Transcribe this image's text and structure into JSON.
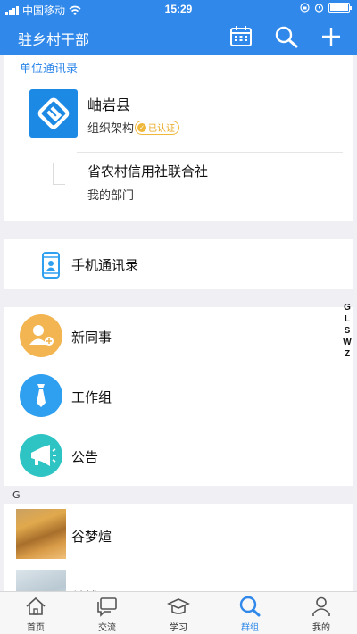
{
  "status_bar": {
    "carrier": "中国移动",
    "time": "15:29"
  },
  "nav": {
    "title": "驻乡村干部",
    "icons": [
      "calendar-icon",
      "search-icon",
      "add-icon"
    ]
  },
  "unit_directory": {
    "section_title": "单位通讯录",
    "org": {
      "name": "岫岩县",
      "subtitle": "组织架构",
      "badge": "已认证"
    },
    "sub_org": {
      "name": "省农村信用社联合社",
      "subtitle": "我的部门"
    }
  },
  "phone_contacts": {
    "label": "手机通讯录"
  },
  "quick_items": [
    {
      "label": "新同事",
      "icon": "new-colleague-icon",
      "color": "#f2b552"
    },
    {
      "label": "工作组",
      "icon": "tie-icon",
      "color": "#2f9ff0"
    },
    {
      "label": "公告",
      "icon": "megaphone-icon",
      "color": "#2fc4c4"
    }
  ],
  "index_letters": [
    "G",
    "L",
    "S",
    "W",
    "Z"
  ],
  "contacts": {
    "group_letter": "G",
    "items": [
      {
        "name": "谷梦煊"
      },
      {
        "name": "关博"
      }
    ]
  },
  "tab_bar": {
    "active": "群组",
    "tabs": [
      {
        "label": "首页",
        "icon": "home-icon"
      },
      {
        "label": "交流",
        "icon": "chat-icon"
      },
      {
        "label": "学习",
        "icon": "graduation-cap-icon"
      },
      {
        "label": "群组",
        "icon": "search-icon"
      },
      {
        "label": "我的",
        "icon": "person-icon"
      }
    ]
  },
  "colors": {
    "primary": "#2f88ea",
    "badge": "#f0b83a"
  }
}
